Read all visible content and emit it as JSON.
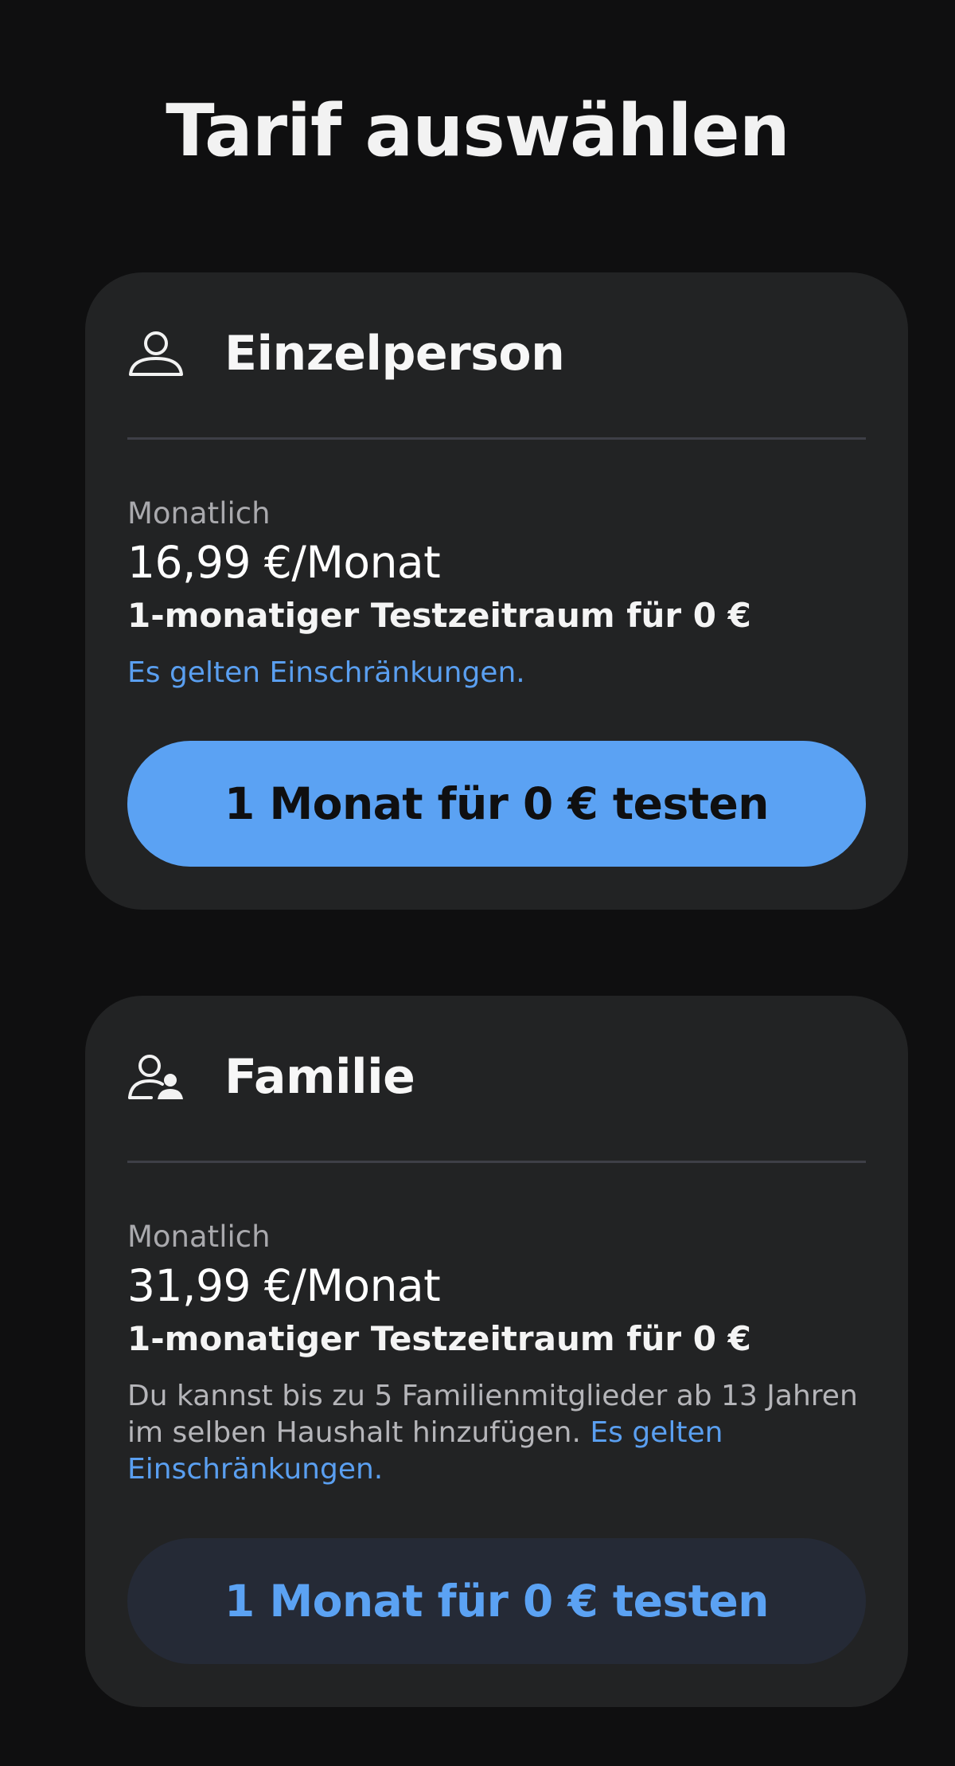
{
  "header": {
    "title": "Tarif auswählen"
  },
  "plans": [
    {
      "name": "Einzelperson",
      "icon": "person-icon",
      "period": "Monatlich",
      "price": "16,99 €/Monat",
      "trial": "1-monatiger Testzeitraum für 0 €",
      "description": "",
      "restrictions_link": "Es gelten Einschränkungen.",
      "cta_label": "1 Monat für 0 € testen"
    },
    {
      "name": "Familie",
      "icon": "family-icon",
      "period": "Monatlich",
      "price": "31,99 €/Monat",
      "trial": "1-monatiger Testzeitraum für 0 €",
      "description": "Du kannst bis zu 5 Familienmitglieder ab 13 Jahren im selben Haushalt hinzufügen. ",
      "restrictions_link": "Es gelten Einschränkungen.",
      "cta_label": "1 Monat für 0 € testen"
    }
  ],
  "colors": {
    "background": "#0f0f10",
    "card": "#222324",
    "accent": "#5ba2f3",
    "secondary_button": "#252a36"
  }
}
